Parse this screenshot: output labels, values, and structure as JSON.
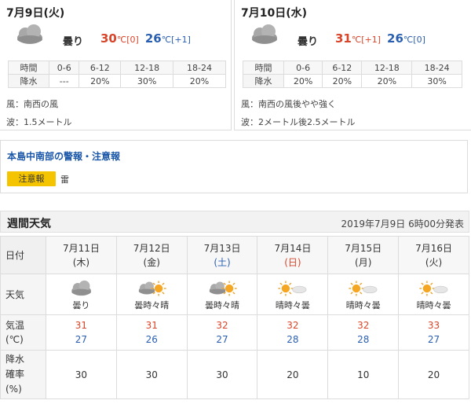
{
  "days": [
    {
      "date": "7月9日(火)",
      "weather": "曇り",
      "icon": "cloudy-icon",
      "high": "30",
      "high_diff": "[0]",
      "low": "26",
      "low_diff": "[+1]",
      "unit": "℃",
      "rain_header_label": "時間",
      "rain_row_label": "降水",
      "rain_periods": [
        "0-6",
        "6-12",
        "12-18",
        "18-24"
      ],
      "rain_values": [
        "---",
        "20%",
        "30%",
        "20%"
      ],
      "wind": "風：南西の風",
      "wave": "波：1.5メートル"
    },
    {
      "date": "7月10日(水)",
      "weather": "曇り",
      "icon": "cloudy-icon",
      "high": "31",
      "high_diff": "[+1]",
      "low": "26",
      "low_diff": "[0]",
      "unit": "℃",
      "rain_header_label": "時間",
      "rain_row_label": "降水",
      "rain_periods": [
        "0-6",
        "6-12",
        "12-18",
        "18-24"
      ],
      "rain_values": [
        "20%",
        "20%",
        "20%",
        "30%"
      ],
      "wind": "風：南西の風後やや強く",
      "wave": "波：2メートル後2.5メートル"
    }
  ],
  "warning": {
    "title": "本島中南部の警報・注意報",
    "badge": "注意報",
    "text": "雷",
    "badge_color": "#f5c400"
  },
  "weekly": {
    "title": "週間天気",
    "issued": "2019年7月9日 6時00分発表",
    "row_labels": {
      "date": "日付",
      "weather": "天気",
      "temp_line1": "気温",
      "temp_line2": "(℃)",
      "prob_line1": "降水",
      "prob_line2": "確率",
      "prob_line3": "(%)"
    },
    "days": [
      {
        "date": "7月11日",
        "dow": "(木)",
        "dow_type": "weekday",
        "weather": "曇り",
        "icon": "cloudy-icon",
        "high": "31",
        "low": "27",
        "prob": "30"
      },
      {
        "date": "7月12日",
        "dow": "(金)",
        "dow_type": "weekday",
        "weather": "曇時々晴",
        "icon": "cloud-sun-icon",
        "high": "31",
        "low": "26",
        "prob": "30"
      },
      {
        "date": "7月13日",
        "dow": "(土)",
        "dow_type": "saturday",
        "weather": "曇時々晴",
        "icon": "cloud-sun-icon",
        "high": "32",
        "low": "27",
        "prob": "30"
      },
      {
        "date": "7月14日",
        "dow": "(日)",
        "dow_type": "sunday",
        "weather": "晴時々曇",
        "icon": "sun-cloud-icon",
        "high": "32",
        "low": "28",
        "prob": "20"
      },
      {
        "date": "7月15日",
        "dow": "(月)",
        "dow_type": "weekday",
        "weather": "晴時々曇",
        "icon": "sun-cloud-icon",
        "high": "32",
        "low": "28",
        "prob": "10"
      },
      {
        "date": "7月16日",
        "dow": "(火)",
        "dow_type": "weekday",
        "weather": "晴時々曇",
        "icon": "sun-cloud-icon",
        "high": "33",
        "low": "27",
        "prob": "20"
      }
    ]
  },
  "colors": {
    "high": "#d9452a",
    "low": "#2a5fb0",
    "link_blue": "#1a56a8"
  }
}
